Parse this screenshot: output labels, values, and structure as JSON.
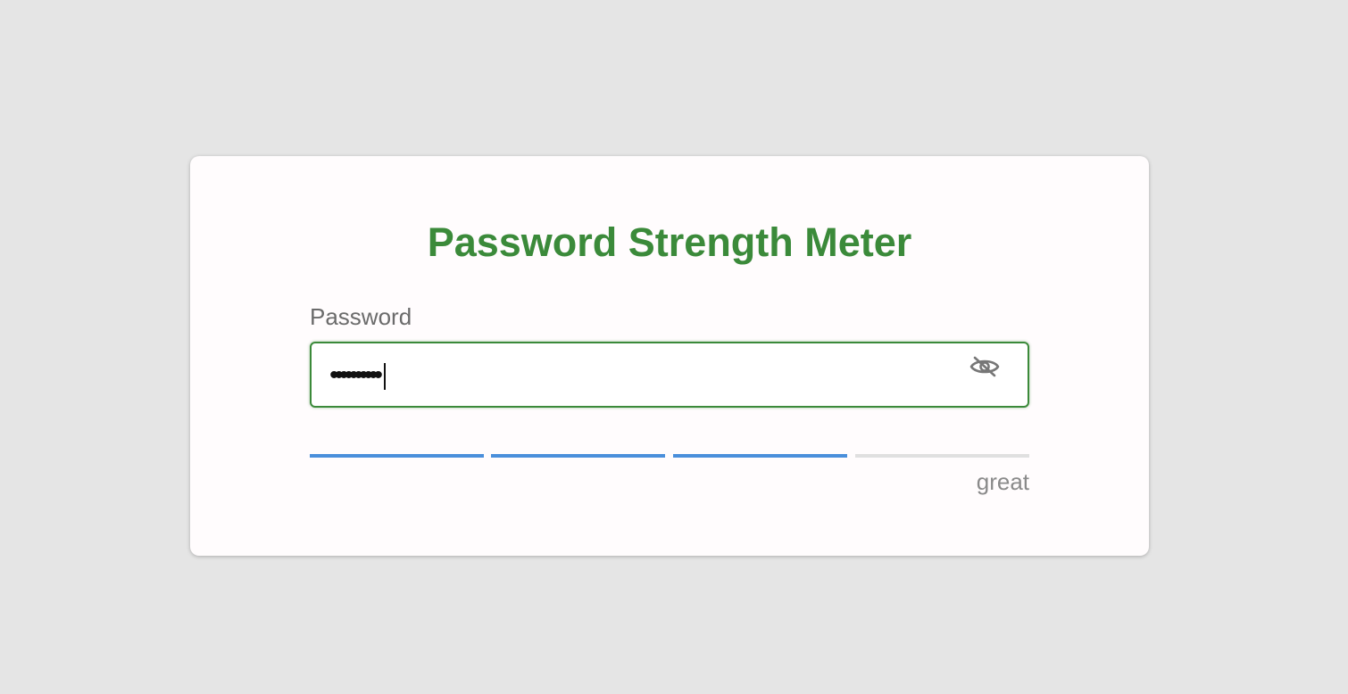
{
  "page": {
    "title": "Password Strength Meter"
  },
  "password_field": {
    "label": "Password",
    "masked_value": "••••••••••",
    "toggle_icon": "eye-slash-icon"
  },
  "strength_meter": {
    "segments_total": 4,
    "segments_filled": 3,
    "label": "great"
  },
  "colors": {
    "accent_green": "#3b8a3a",
    "meter_filled": "#4a8fdb",
    "meter_empty": "#e0e0e0",
    "page_background": "#e5e5e5",
    "card_background": "#fffcfd"
  }
}
